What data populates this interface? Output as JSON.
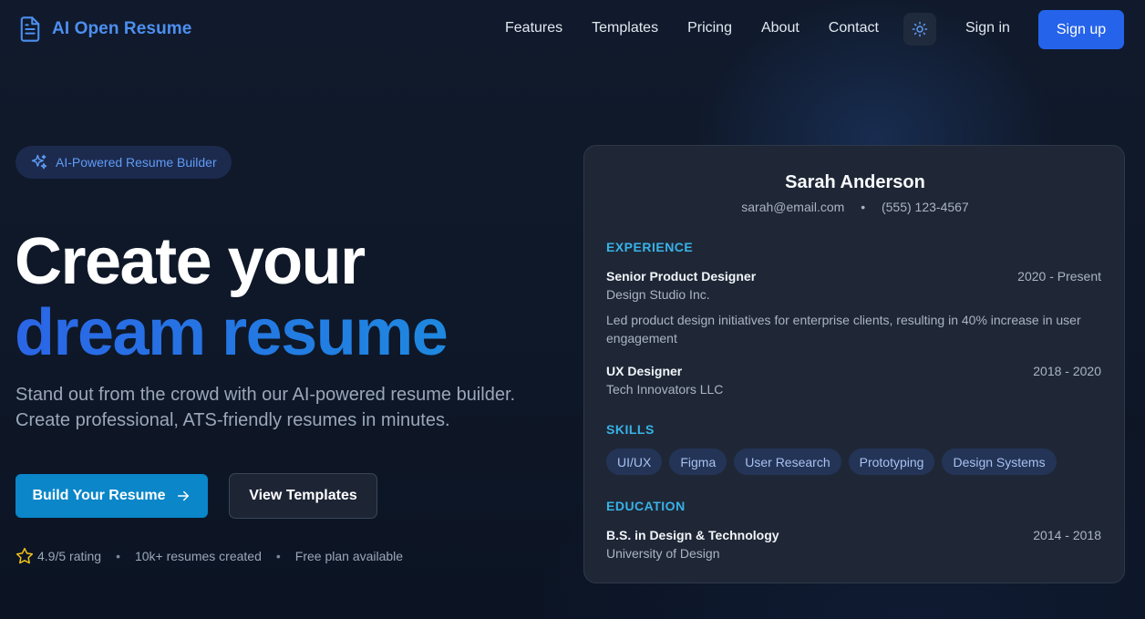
{
  "nav": {
    "brand": "AI Open Resume",
    "links": [
      "Features",
      "Templates",
      "Pricing",
      "About",
      "Contact"
    ],
    "theme_icon": "sun-icon",
    "signin": "Sign in",
    "signup": "Sign up"
  },
  "hero": {
    "badge": "AI-Powered Resume Builder",
    "title_line1": "Create your",
    "title_line2": "dream resume",
    "subtitle_line1": "Stand out from the crowd with our AI-powered resume builder.",
    "subtitle_line2": "Create professional, ATS-friendly resumes in minutes.",
    "primary_button": "Build Your Resume",
    "secondary_button": "View Templates",
    "stats": {
      "rating": "4.9/5 rating",
      "resumes": "10k+ resumes created",
      "plan": "Free plan available"
    }
  },
  "resume": {
    "name": "Sarah Anderson",
    "email": "sarah@email.com",
    "phone": "(555) 123-4567",
    "experience_heading": "EXPERIENCE",
    "jobs": [
      {
        "title": "Senior Product Designer",
        "dates": "2020 - Present",
        "company": "Design Studio Inc.",
        "description": "Led product design initiatives for enterprise clients, resulting in 40% increase in user engagement"
      },
      {
        "title": "UX Designer",
        "dates": "2018 - 2020",
        "company": "Tech Innovators LLC"
      }
    ],
    "skills_heading": "SKILLS",
    "skills": [
      "UI/UX",
      "Figma",
      "User Research",
      "Prototyping",
      "Design Systems"
    ],
    "education_heading": "EDUCATION",
    "education": {
      "degree": "B.S. in Design & Technology",
      "dates": "2014 - 2018",
      "school": "University of Design"
    }
  },
  "colors": {
    "accent": "#2563eb",
    "primary_button": "#0a86c9",
    "section_heading": "#38b2e8",
    "star": "#f5c518"
  }
}
